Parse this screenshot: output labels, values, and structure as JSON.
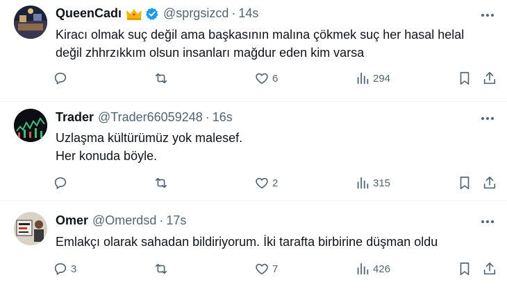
{
  "colors": {
    "text": "#0f1419",
    "secondary": "#536471",
    "verified": "#1d9bf0",
    "divider": "#eff3f4",
    "crown": "#f4b400"
  },
  "tweets": [
    {
      "name": "QueenCadı",
      "handle": "@sprgsizcd",
      "separator": "·",
      "time": "14s",
      "text_line1": "Kiracı olmak suç değil ama başkasının malına çökmek suç her hasal helal",
      "text_line2": "değil zhhrzıkkım olsun insanları mağdur eden kim varsa",
      "replies": "",
      "retweets": "",
      "likes": "6",
      "views": "294"
    },
    {
      "name": "Trader",
      "handle": "@Trader66059248",
      "separator": "·",
      "time": "16s",
      "text_line1": "Uzlaşma kültürümüz yok malesef.",
      "text_line2": "Her konuda böyle.",
      "replies": "",
      "retweets": "",
      "likes": "2",
      "views": "315"
    },
    {
      "name": "Omer",
      "handle": "@Omerdsd",
      "separator": "·",
      "time": "17s",
      "text_line1": "Emlakçı olarak sahadan bildiriyorum. İki tarafta birbirine düşman oldu",
      "replies": "3",
      "retweets": "",
      "likes": "7",
      "views": "426"
    }
  ]
}
